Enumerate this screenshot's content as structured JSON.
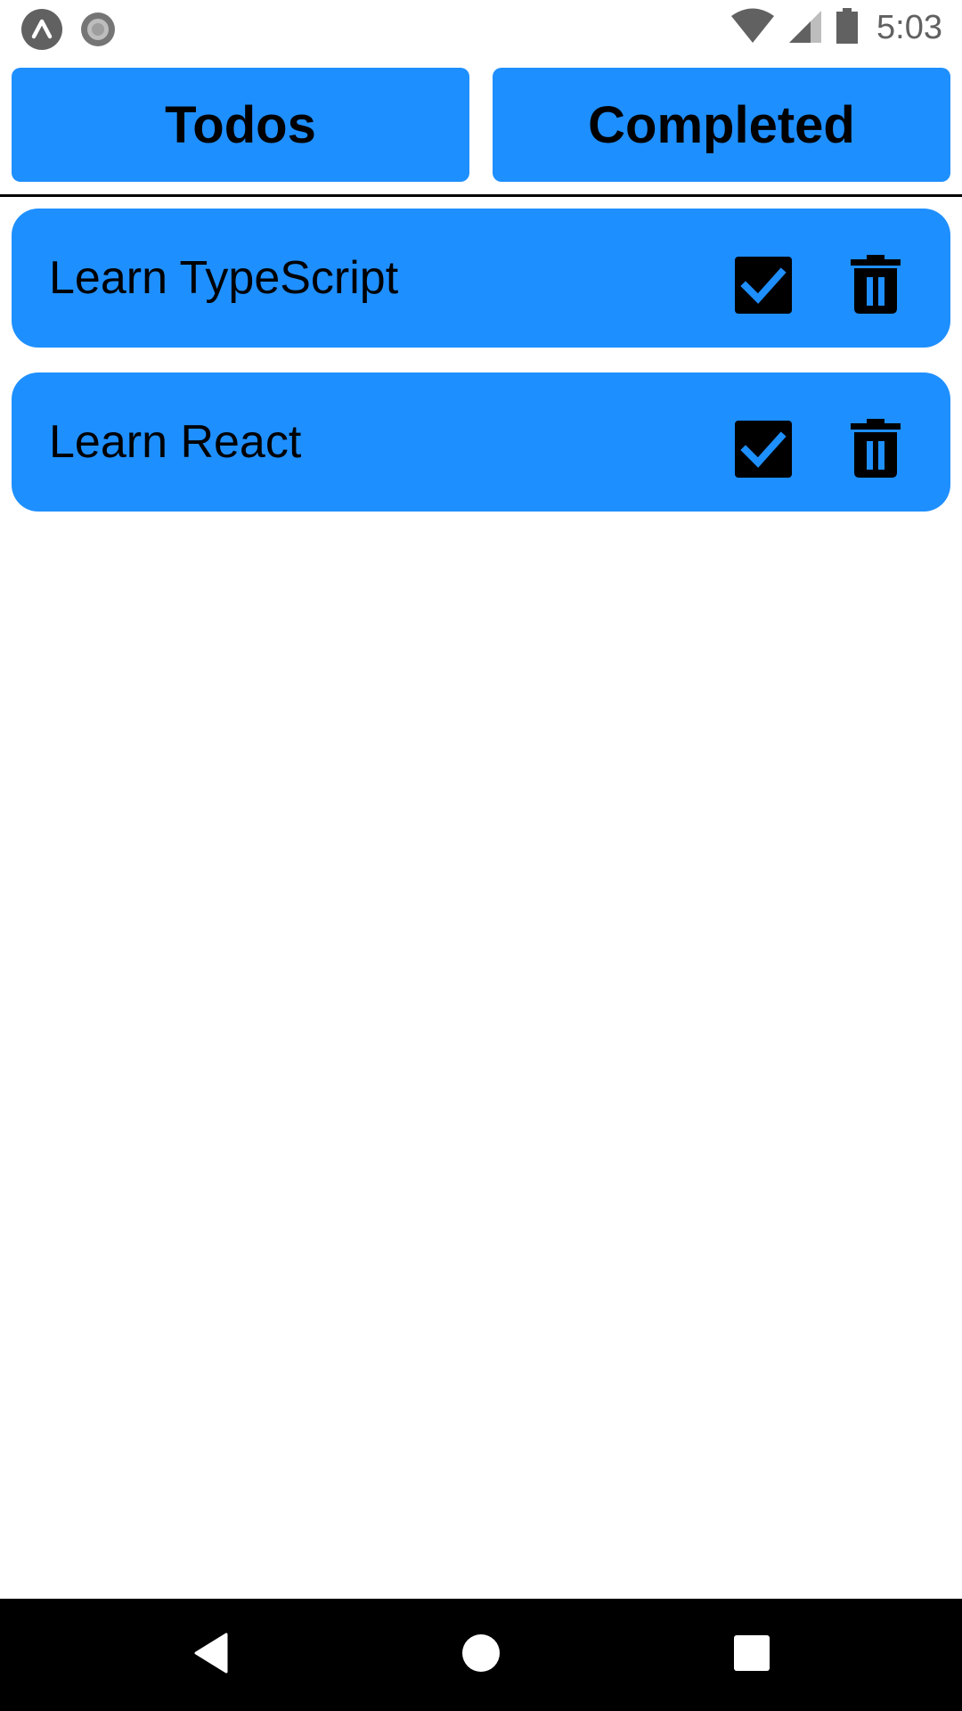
{
  "status_bar": {
    "left_icons": [
      "expo-logo-icon",
      "record-circle-icon"
    ],
    "right_icons": [
      "wifi-icon",
      "cell-signal-icon",
      "battery-icon"
    ],
    "time": "5:03"
  },
  "tabs": [
    {
      "label": "Todos"
    },
    {
      "label": "Completed"
    }
  ],
  "todos": [
    {
      "label": "Learn TypeScript",
      "checked": true
    },
    {
      "label": "Learn React",
      "checked": true
    }
  ],
  "nav_bar": {
    "buttons": [
      "back-icon",
      "home-icon",
      "recents-icon"
    ]
  },
  "colors": {
    "accent": "#1e8fff",
    "text": "#000000",
    "status_icon": "#616161"
  }
}
